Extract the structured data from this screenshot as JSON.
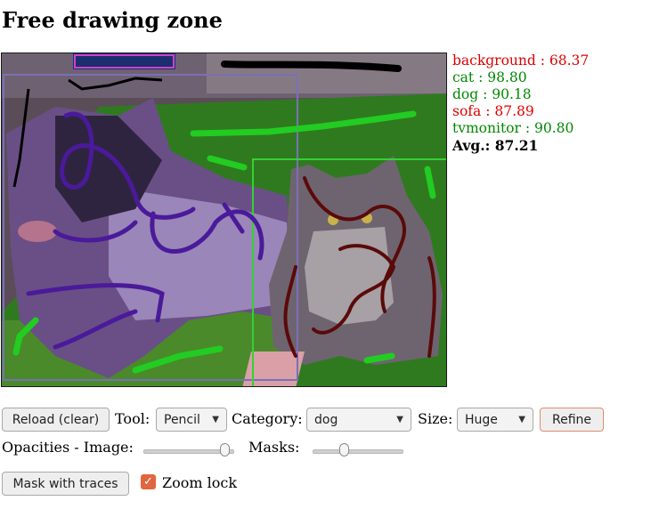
{
  "page_title": "Free drawing zone",
  "scores": [
    {
      "label": "background : 68.37",
      "color": "#dd0000"
    },
    {
      "label": "cat : 98.80",
      "color": "#008800"
    },
    {
      "label": "dog : 90.18",
      "color": "#008800"
    },
    {
      "label": "sofa : 87.89",
      "color": "#dd0000"
    },
    {
      "label": "tvmonitor : 90.80",
      "color": "#008800"
    }
  ],
  "avg": "Avg.: 87.21",
  "toolbar": {
    "reload_label": "Reload (clear)",
    "tool_label": "Tool:",
    "tool_value": "Pencil",
    "category_label": "Category:",
    "category_value": "dog",
    "size_label": "Size:",
    "size_value": "Huge",
    "refine_label": "Refine"
  },
  "opacities": {
    "image_label": "Opacities - Image:",
    "masks_label": "Masks:",
    "image_level": 0.9,
    "masks_level": 0.35
  },
  "bottom": {
    "mask_traces_label": "Mask with traces",
    "zoom_lock_label": "Zoom lock",
    "zoom_lock_checked": true
  },
  "colors": {
    "score_good": "#008800",
    "score_bad": "#dd0000",
    "accent": "#e0663f"
  }
}
